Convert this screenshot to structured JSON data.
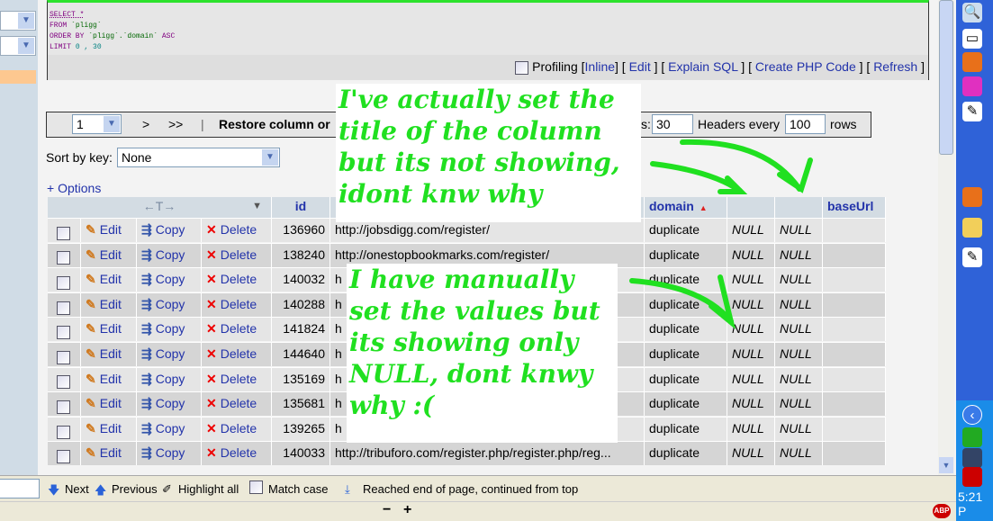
{
  "sql": {
    "line1": "SELECT *",
    "line2_kw": "FROM",
    "line2_tbl": "`pligg`",
    "line3_kw": "ORDER BY",
    "line3_col": "`pligg`.`domain`",
    "line3_dir": "ASC",
    "line4_kw": "LIMIT",
    "line4_vals": "0 , 30"
  },
  "query_links": {
    "profiling": "Profiling",
    "inline": "Inline",
    "edit": "Edit",
    "explain": "Explain SQL",
    "php": "Create PHP Code",
    "refresh": "Refresh"
  },
  "nav": {
    "page": "1",
    "next": ">",
    "last": ">>",
    "restore": "Restore column or",
    "rows_label": "s:",
    "rows_value": "30",
    "headers_label": "Headers every",
    "headers_value": "100",
    "rows_suffix": "rows"
  },
  "sort": {
    "label": "Sort by key:",
    "value": "None"
  },
  "options_link": "+ Options",
  "table": {
    "headers": [
      "id",
      "",
      "domain",
      "",
      "",
      "baseUrl"
    ],
    "sort_indicator": "▲",
    "actions": {
      "edit": "Edit",
      "copy": "Copy",
      "delete": "Delete"
    },
    "rows": [
      {
        "id": "136960",
        "url": "http://jobsdigg.com/register/",
        "domain": "duplicate",
        "c1": "NULL",
        "c2": "NULL"
      },
      {
        "id": "138240",
        "url": "http://onestopbookmarks.com/register/",
        "domain": "duplicate",
        "c1": "NULL",
        "c2": "NULL"
      },
      {
        "id": "140032",
        "url": "h",
        "domain": "duplicate",
        "c1": "NULL",
        "c2": "NULL"
      },
      {
        "id": "140288",
        "url": "h",
        "domain": "duplicate",
        "c1": "NULL",
        "c2": "NULL"
      },
      {
        "id": "141824",
        "url": "h",
        "domain": "duplicate",
        "c1": "NULL",
        "c2": "NULL"
      },
      {
        "id": "144640",
        "url": "h",
        "domain": "duplicate",
        "c1": "NULL",
        "c2": "NULL"
      },
      {
        "id": "135169",
        "url": "h",
        "domain": "duplicate",
        "c1": "NULL",
        "c2": "NULL"
      },
      {
        "id": "135681",
        "url": "h",
        "domain": "duplicate",
        "c1": "NULL",
        "c2": "NULL"
      },
      {
        "id": "139265",
        "url": "h",
        "domain": "duplicate",
        "c1": "NULL",
        "c2": "NULL"
      },
      {
        "id": "140033",
        "url": "http://tribuforo.com/register.php/register.php/reg...",
        "domain": "duplicate",
        "c1": "NULL",
        "c2": "NULL"
      }
    ]
  },
  "annotations": {
    "top": "I've actually set the title of the column but its not showing, idont knw why",
    "bottom": "I have manually set the values but its showing only NULL, dont knwy why :("
  },
  "findbar": {
    "next": "Next",
    "previous": "Previous",
    "highlight": "Highlight all",
    "match_case": "Match case",
    "status": "Reached end of page, continued from top"
  },
  "statusbar": {
    "zoom_out": "−",
    "zoom_in": "+",
    "abp": "ABP"
  },
  "taskbar": {
    "clock": "5:21 P"
  },
  "colors": {
    "annotation": "#20e020",
    "link": "#2233aa",
    "header_bg": "#d3dce3",
    "taskbar": "#2f62d8"
  }
}
